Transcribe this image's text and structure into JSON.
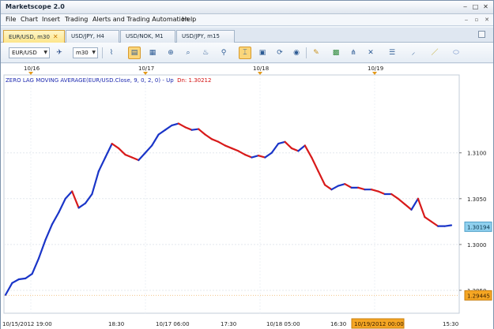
{
  "app": {
    "title": "Marketscope 2.0"
  },
  "window_buttons": {
    "minimize": "‒",
    "maximize": "□",
    "close": "✕"
  },
  "menu": [
    "File",
    "Chart",
    "Insert",
    "Trading",
    "Alerts and Trading Automation",
    "Help"
  ],
  "tabs": [
    {
      "label": "EUR/USD, m30",
      "active": true
    },
    {
      "label": "USD/JPY, H4",
      "active": false
    },
    {
      "label": "USD/NOK, M1",
      "active": false
    },
    {
      "label": "USD/JPY, m15",
      "active": false
    }
  ],
  "toolbar": {
    "instrument": "EUR/USD",
    "timeframe": "m30",
    "icons": [
      "chart-type-icon",
      "candles-icon",
      "bars-icon",
      "crosshair-icon",
      "zoom-icon",
      "cursor-icon",
      "snapshot-icon",
      "refresh-icon",
      "globe-icon",
      "ruler-icon",
      "image-icon",
      "fibonacci-icon",
      "lines-icon",
      "pen-icon",
      "trendline-icon",
      "ellipse-icon"
    ]
  },
  "indicator": {
    "label": "ZERO LAG MOVING AVERAGE(EUR/USD.Close, 9, 0, 2, 0) -  Up",
    "dn_label": "Dn: 1.30212"
  },
  "colors": {
    "up": "#1a35c8",
    "dn": "#d81a1a",
    "accent": "#fbd67a",
    "current_price_bg": "#8fd0ee",
    "low_price_bg": "#f5a623"
  },
  "chart_data": {
    "type": "line",
    "instrument": "EUR/USD",
    "timeframe": "m30",
    "ylim": [
      1.2925,
      1.3185
    ],
    "y_ticks": [
      "1.3100",
      "1.3050",
      "1.3000",
      "1.2950"
    ],
    "top_date_labels": [
      "10/16",
      "10/17",
      "10/18",
      "10/19"
    ],
    "x_tick_labels": [
      "10/15/2012 19:00",
      "18:30",
      "10/17 06:00",
      "17:30",
      "10/18 05:00",
      "16:30",
      "10/19/2012 00:00",
      "15:30"
    ],
    "current_price": "1.30194",
    "low_price": "1.29445",
    "crosshair_time": "10/19/2012 00:00",
    "series": [
      {
        "values": [
          1.2945,
          1.2958,
          1.2962,
          1.2963,
          1.2968,
          1.2985,
          1.3005,
          1.3022,
          1.3035,
          1.305,
          1.3058,
          1.304,
          1.3045,
          1.3055,
          1.308,
          1.3095,
          1.311,
          1.3105,
          1.3098,
          1.3095,
          1.3092,
          1.31,
          1.3108,
          1.312,
          1.3125,
          1.313,
          1.3132,
          1.3128,
          1.3125,
          1.3126,
          1.312,
          1.3115,
          1.3112,
          1.3108,
          1.3105,
          1.3102,
          1.3098,
          1.3095,
          1.3097,
          1.3095,
          1.31,
          1.311,
          1.3112,
          1.3105,
          1.3102,
          1.3108,
          1.3095,
          1.308,
          1.3065,
          1.306,
          1.3064,
          1.3066,
          1.3062,
          1.3062,
          1.306,
          1.306,
          1.3058,
          1.3055,
          1.3055,
          1.305,
          1.3044,
          1.3038,
          1.305,
          1.303,
          1.3025,
          1.302,
          1.302,
          1.3021
        ],
        "last_value": 1.30212
      }
    ]
  }
}
